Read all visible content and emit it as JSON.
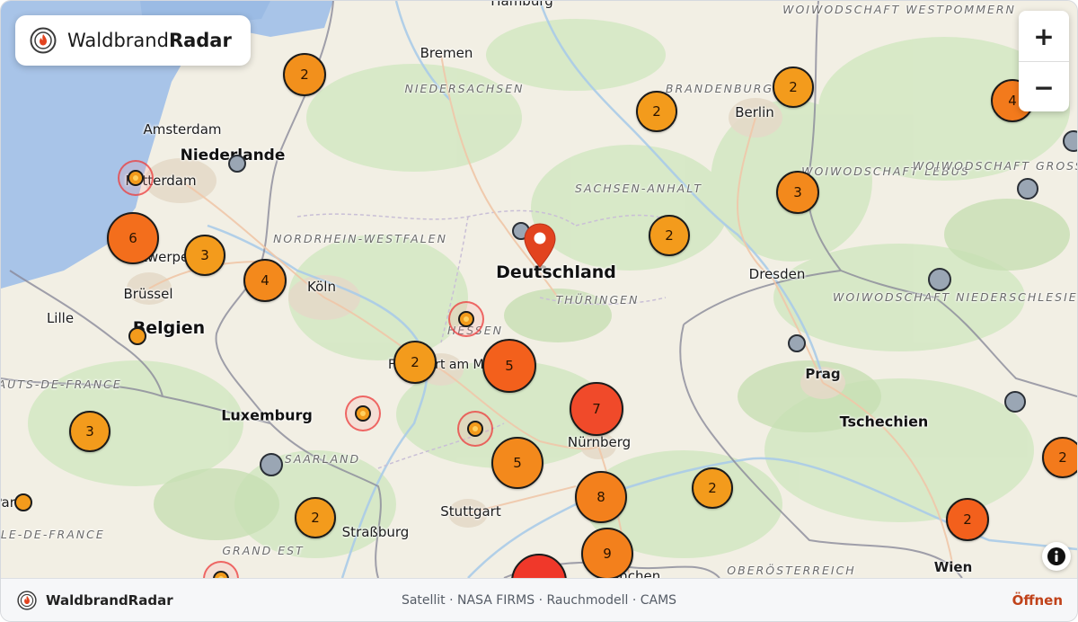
{
  "brand": {
    "name_light": "Waldbrand",
    "name_bold": "Radar"
  },
  "zoom": {
    "in_label": "+",
    "out_label": "−"
  },
  "info": {
    "label": "i"
  },
  "footer": {
    "brand": "WaldbrandRadar",
    "credits": "Satellit · NASA FIRMS · Rauchmodell · CAMS",
    "open_label": "Öffnen"
  },
  "map": {
    "countries": [
      "Deutschland",
      "Niederlande",
      "Belgien",
      "Luxemburg",
      "Tschechien"
    ],
    "cities": [
      "Amsterdam",
      "Rotterdam",
      "Antwerpen",
      "Brüssel",
      "Lille",
      "Köln",
      "Frankfurt am Main",
      "Stuttgart",
      "Straßburg",
      "Bremen",
      "Hamburg",
      "Berlin",
      "Dresden",
      "Prag",
      "Nürnberg",
      "München",
      "Wien",
      "Paris"
    ],
    "regions": [
      "NIEDERSACHSEN",
      "NORDRHEIN-WESTFALEN",
      "SACHSEN-ANHALT",
      "THÜRINGEN",
      "HESSEN",
      "SAARLAND",
      "GRAND EST",
      "BRANDENBURG",
      "WOIWODSCHAFT WESTPOMMERN",
      "WOIWODSCHAFT LEBUS",
      "WOIWODSCHAFT GROSSPOLEN",
      "WOIWODSCHAFT NIEDERSCHLESIEN",
      "HAUTS-DE-FRANCE",
      "ÎLE-DE-FRANCE",
      "OBERÖSTERREICH"
    ],
    "clusters": [
      {
        "count": "2",
        "color": "#f2901c"
      },
      {
        "count": "2",
        "color": "#f39b1c"
      },
      {
        "count": "2",
        "color": "#f39b1c"
      },
      {
        "count": "4",
        "color": "#f37a1c"
      },
      {
        "count": "2",
        "color": "#f39b1c"
      },
      {
        "count": "6",
        "color": "#f36e1c"
      },
      {
        "count": "3",
        "color": "#f39b1c"
      },
      {
        "count": "4",
        "color": "#f3891c"
      },
      {
        "count": "3",
        "color": "#f3891c"
      },
      {
        "count": "2",
        "color": "#f39b1c"
      },
      {
        "count": "2",
        "color": "#f37a1c"
      },
      {
        "count": "5",
        "color": "#f3601c"
      },
      {
        "count": "7",
        "color": "#f04a2a"
      },
      {
        "count": "3",
        "color": "#f39b1c"
      },
      {
        "count": "5",
        "color": "#f3891c"
      },
      {
        "count": "8",
        "color": "#f3801c"
      },
      {
        "count": "2",
        "color": "#f39b1c"
      },
      {
        "count": "9",
        "color": "#f3801c"
      },
      {
        "count": "2",
        "color": "#f39b1c"
      },
      {
        "count": "2",
        "color": "#f3601c"
      },
      {
        "count": "2",
        "color": "#f39b1c"
      }
    ]
  }
}
